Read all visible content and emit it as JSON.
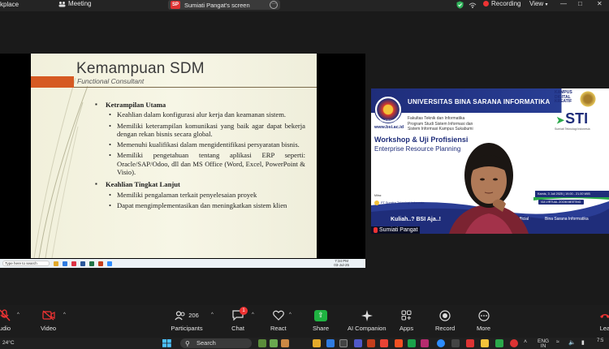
{
  "window": {
    "app_title": "kplace",
    "meeting_label": "Meeting",
    "share_badge": "SP",
    "share_label": "Sumiati Pangat's screen",
    "recording_label": "Recording",
    "view_label": "View",
    "min_glyph": "—",
    "max_glyph": "□",
    "close_glyph": "✕"
  },
  "slide": {
    "title": "Kemampuan SDM",
    "subtitle": "Functional Consultant",
    "section1": "Ketrampilan Utama",
    "bullets1": [
      "Keahlian dalam konfigurasi alur kerja dan keamanan sistem.",
      "Memiliki keterampilan komunikasi yang baik agar dapat bekerja dengan rekan bisnis secara global.",
      "Memenuhi kualifikasi dalam mengidentifikasi persyaratan bisnis.",
      "Memiliki pengetahuan tentang aplikasi ERP seperti: Oracle/SAP/Odoo, dll dan MS Office (Word, Excel, PowerPoint & Visio)."
    ],
    "section2": "Keahlian Tingkat Lanjut",
    "bullets2": [
      "Memiliki pengalaman terkait penyelesaian proyek",
      "Dapat mengimplementasikan dan meningkatkan sistem klien"
    ],
    "taskbar_search": "Type here to search",
    "clock_time": "7:34 PM",
    "clock_date": "03-Jul-25"
  },
  "panel": {
    "university": "UNIVERSITAS BINA SARANA INFORMATIKA",
    "university_caption": "UNIVERSITAS",
    "website": "www.bsi.ac.id",
    "faculty_lines": [
      "Fakultas Teknik dan Informatika",
      "Program Studi Sistem Informasi dan",
      "Sistem Informasi Kampus Sukabumi"
    ],
    "kampus": "KAMPUS DIGITAL KREATIF",
    "sti_logo": "STI",
    "sti_caption": "Sumiati Teknologi Indonesia",
    "workshop_title": "Workshop & Uji Profisiensi",
    "workshop_sub": "Enterprise Resource Planning",
    "date_text": "Kamis, 3 Juli 2025 | 19.00 - 21.00 WIB",
    "zoom_text": "VIA VIRTUAL ZOOM MEETING",
    "mitra": "Mitra:",
    "partner": "PT Sumitra Teknologi Indonesia",
    "kuliah": "Kuliah..? BSI Aja..!",
    "social1": "@ubsi_official",
    "social2": "Bina Sarana Informatika",
    "participant_name": "Sumiati Pangat"
  },
  "controls": {
    "audio": "udio",
    "video": "Video",
    "participants": "Participants",
    "participants_count": "206",
    "chat": "Chat",
    "chat_badge": "1",
    "react": "React",
    "share": "Share",
    "ai": "AI Companion",
    "apps": "Apps",
    "record": "Record",
    "more": "More",
    "leave": "Lea",
    "caret": "^"
  },
  "taskbar": {
    "weather": "24°C",
    "search": "Search",
    "lang": "ENG",
    "lang2": "IN",
    "clock": "7:5"
  }
}
